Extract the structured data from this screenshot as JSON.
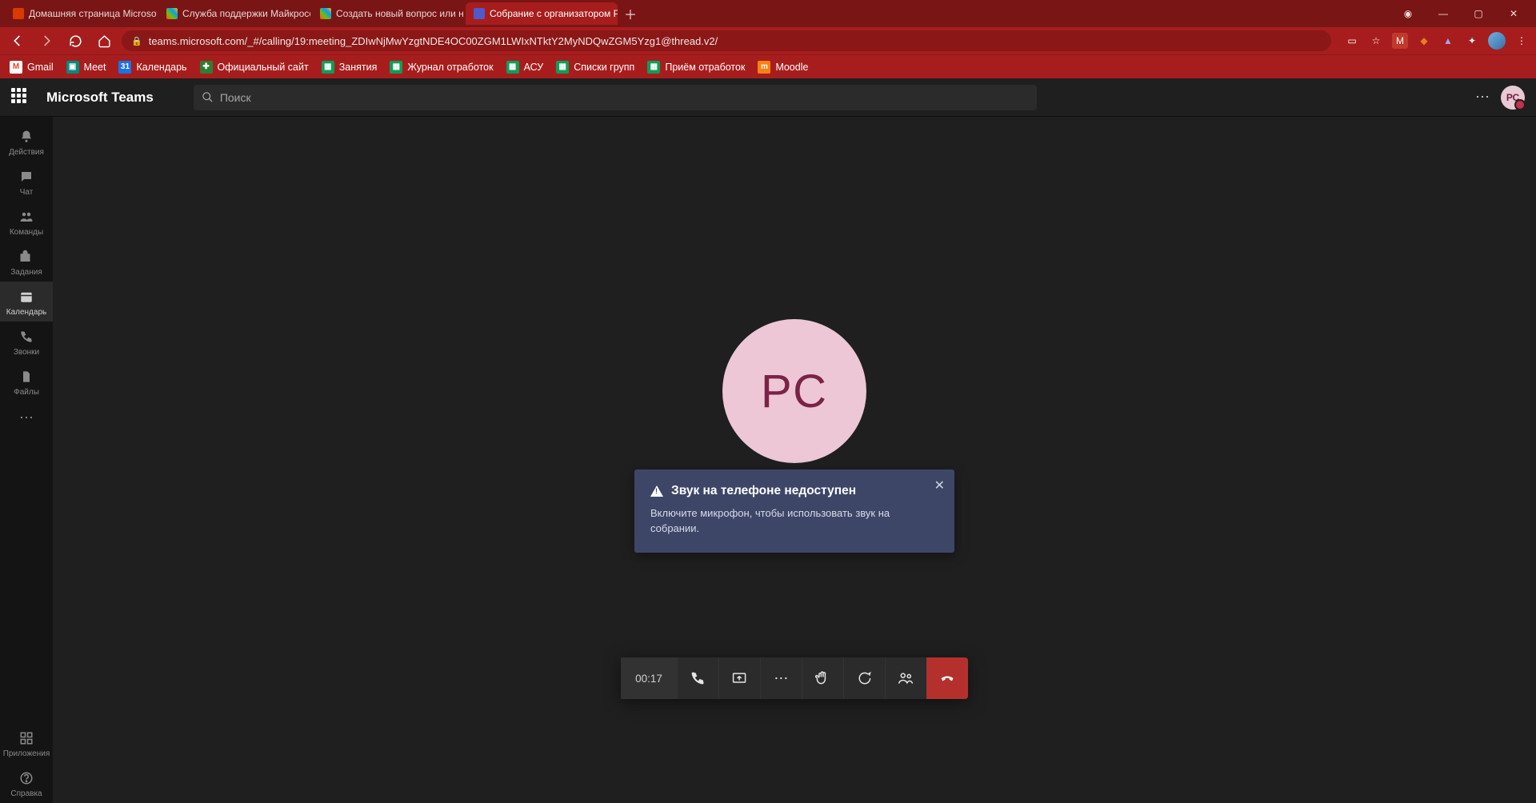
{
  "browser": {
    "tabs": [
      {
        "title": "Домашняя страница Microsoft O",
        "favicon": "#d73b02"
      },
      {
        "title": "Служба поддержки Майкрософ",
        "favicon": "#2e7d32"
      },
      {
        "title": "Создать новый вопрос или нач",
        "favicon": "#2e7d32"
      },
      {
        "title": "Собрание с организатором Рук",
        "favicon": "#5059c9",
        "active": true
      }
    ],
    "url": "teams.microsoft.com/_#/calling/19:meeting_ZDIwNjMwYzgtNDE4OC00ZGM1LWIxNTktY2MyNDQwZGM5Yzg1@thread.v2/",
    "bookmarks": [
      {
        "label": "Gmail",
        "color": "#ea4335"
      },
      {
        "label": "Meet",
        "color": "#00897b"
      },
      {
        "label": "Календарь",
        "color": "#1a73e8"
      },
      {
        "label": "Официальный сайт",
        "color": "#2e7d32"
      },
      {
        "label": "Занятия",
        "color": "#0f9d58"
      },
      {
        "label": "Журнал отработок",
        "color": "#0f9d58"
      },
      {
        "label": "АСУ",
        "color": "#0f9d58"
      },
      {
        "label": "Списки групп",
        "color": "#0f9d58"
      },
      {
        "label": "Приём отработок",
        "color": "#0f9d58"
      },
      {
        "label": "Moodle",
        "color": "#f98012"
      }
    ]
  },
  "teams": {
    "app_title": "Microsoft Teams",
    "search_placeholder": "Поиск",
    "avatar_initials": "РС",
    "rail": [
      {
        "id": "activity",
        "label": "Действия"
      },
      {
        "id": "chat",
        "label": "Чат"
      },
      {
        "id": "teams",
        "label": "Команды"
      },
      {
        "id": "assignments",
        "label": "Задания"
      },
      {
        "id": "calendar",
        "label": "Календарь",
        "active": true
      },
      {
        "id": "calls",
        "label": "Звонки"
      },
      {
        "id": "files",
        "label": "Файлы"
      }
    ],
    "rail_bottom": [
      {
        "id": "apps",
        "label": "Приложения"
      },
      {
        "id": "help",
        "label": "Справка"
      }
    ]
  },
  "meeting": {
    "participant_initials": "РС",
    "notification": {
      "title": "Звук на телефоне недоступен",
      "body": "Включите микрофон, чтобы использовать звук на собрании."
    },
    "callbar": {
      "timer": "00:17"
    }
  }
}
